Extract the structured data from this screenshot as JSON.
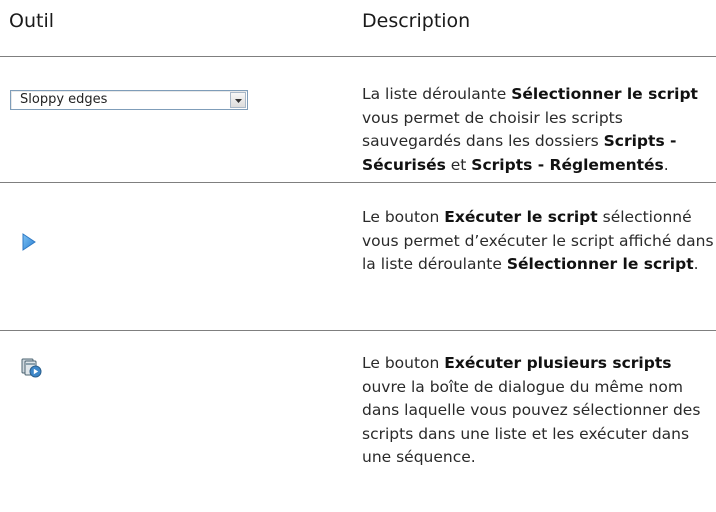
{
  "table": {
    "col_tool": "Outil",
    "col_description": "Description"
  },
  "rows": [
    {
      "tool": {
        "type": "dropdown",
        "value": "Sloppy edges",
        "icon": "chevron-down-icon"
      },
      "desc": [
        {
          "t": "La liste déroulante ",
          "b": false
        },
        {
          "t": "Sélectionner le script",
          "b": true
        },
        {
          "t": " vous permet de choisir les scripts sauvegardés dans les dossiers ",
          "b": false
        },
        {
          "t": "Scripts - Sécurisés",
          "b": true
        },
        {
          "t": " et ",
          "b": false
        },
        {
          "t": "Scripts - Réglementés",
          "b": true
        },
        {
          "t": ".",
          "b": false
        }
      ]
    },
    {
      "tool": {
        "type": "icon",
        "icon": "play-icon"
      },
      "desc": [
        {
          "t": "Le bouton ",
          "b": false
        },
        {
          "t": "Exécuter le script",
          "b": true
        },
        {
          "t": " sélectionné vous permet d’exécuter le script affiché dans la liste déroulante ",
          "b": false
        },
        {
          "t": "Sélectionner le script",
          "b": true
        },
        {
          "t": ".",
          "b": false
        }
      ]
    },
    {
      "tool": {
        "type": "icon",
        "icon": "run-multiple-scripts-icon"
      },
      "desc": [
        {
          "t": "Le bouton ",
          "b": false
        },
        {
          "t": "Exécuter plusieurs scripts",
          "b": true
        },
        {
          "t": " ouvre la boîte de dialogue du même nom dans laquelle vous pouvez sélectionner des scripts dans une liste et les exécuter dans une séquence.",
          "b": false
        }
      ]
    }
  ],
  "colors": {
    "rule": "#7f7f7f",
    "play_icon": "#3b8fd9",
    "dropdown_border": "#7f9db9"
  }
}
